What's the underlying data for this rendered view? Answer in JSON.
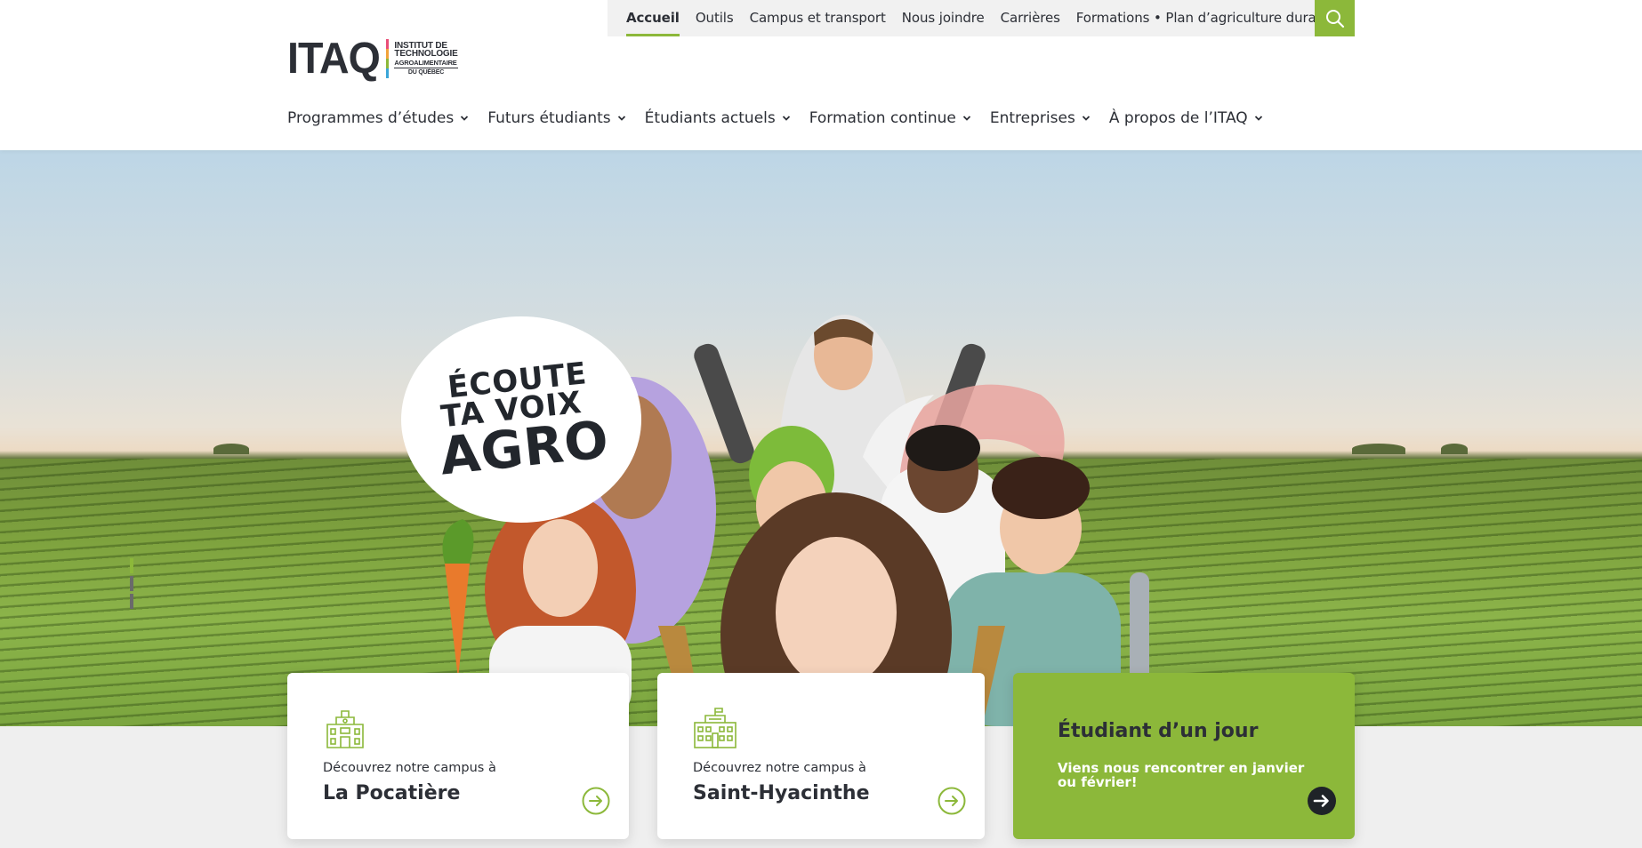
{
  "utility_nav": {
    "items": [
      "Accueil",
      "Outils",
      "Campus et transport",
      "Nous joindre",
      "Carrières",
      "Formations • Plan d’agriculture durable"
    ],
    "active_index": 0
  },
  "logo": {
    "mark": "ITAQ",
    "line1": "INSTITUT DE",
    "line2": "TECHNOLOGIE",
    "line3": "AGROALIMENTAIRE",
    "line4": "DU QUÉBEC"
  },
  "main_nav": {
    "items": [
      "Programmes d’études",
      "Futurs étudiants",
      "Étudiants actuels",
      "Formation continue",
      "Entreprises",
      "À propos de l’ITAQ"
    ]
  },
  "hero": {
    "bubble_line1": "ÉCOUTE",
    "bubble_line2": "TA VOIX",
    "bubble_line3": "AGRO",
    "slides_total": 4,
    "slide_active": 1
  },
  "cards": {
    "campus1": {
      "pre": "Découvrez notre campus à",
      "name": "La Pocatière"
    },
    "campus2": {
      "pre": "Découvrez notre campus à",
      "name": "Saint-Hyacinthe"
    },
    "student": {
      "title": "Étudiant d’un jour",
      "subtitle": "Viens nous rencontrer en janvier ou février!"
    }
  },
  "colors": {
    "accent": "#8cb83a",
    "text": "#2c2f36",
    "band": "#efefef"
  },
  "icons": {
    "search": "search-icon",
    "chevron": "chevron-down-icon",
    "campus1": "school-building-icon",
    "campus2": "campus-building-icon",
    "arrow": "arrow-right-circle-icon"
  }
}
